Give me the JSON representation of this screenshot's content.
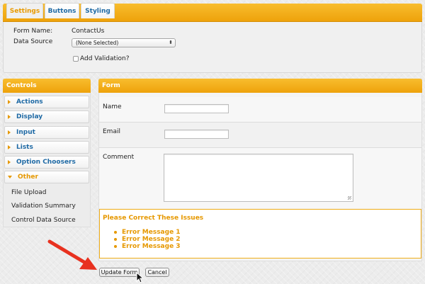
{
  "tabs": [
    {
      "label": "Settings",
      "active": true
    },
    {
      "label": "Buttons",
      "active": false
    },
    {
      "label": "Styling",
      "active": false
    }
  ],
  "settings": {
    "form_name_label": "Form Name:",
    "form_name_value": "ContactUs",
    "data_source_label": "Data Source",
    "data_source_value": "(None Selected)",
    "add_validation_label": "Add Validation?",
    "add_validation_checked": false
  },
  "controls": {
    "title": "Controls",
    "items": [
      {
        "label": "Actions",
        "expanded": false
      },
      {
        "label": "Display",
        "expanded": false
      },
      {
        "label": "Input",
        "expanded": false
      },
      {
        "label": "Lists",
        "expanded": false
      },
      {
        "label": "Option Choosers",
        "expanded": false
      },
      {
        "label": "Other",
        "expanded": true
      }
    ],
    "other_children": [
      "File Upload",
      "Validation Summary",
      "Control Data Source"
    ]
  },
  "form": {
    "title": "Form",
    "fields": [
      {
        "label": "Name",
        "value": ""
      },
      {
        "label": "Email",
        "value": ""
      },
      {
        "label": "Comment",
        "value": ""
      }
    ],
    "validation": {
      "title": "Please Correct These Issues",
      "messages": [
        "Error Message 1",
        "Error Message 2",
        "Error Message 3"
      ]
    }
  },
  "actions": {
    "update_label": "Update Form",
    "cancel_label": "Cancel"
  },
  "colors": {
    "accent": "#f2a81d",
    "link": "#1f6aa5",
    "error": "#e69800",
    "annotation_arrow": "#e8311f"
  },
  "icons": [
    "collapsed-arrow-icon",
    "expanded-arrow-icon",
    "select-chevron-icon",
    "red-arrow-annotation",
    "mouse-pointer-icon"
  ]
}
